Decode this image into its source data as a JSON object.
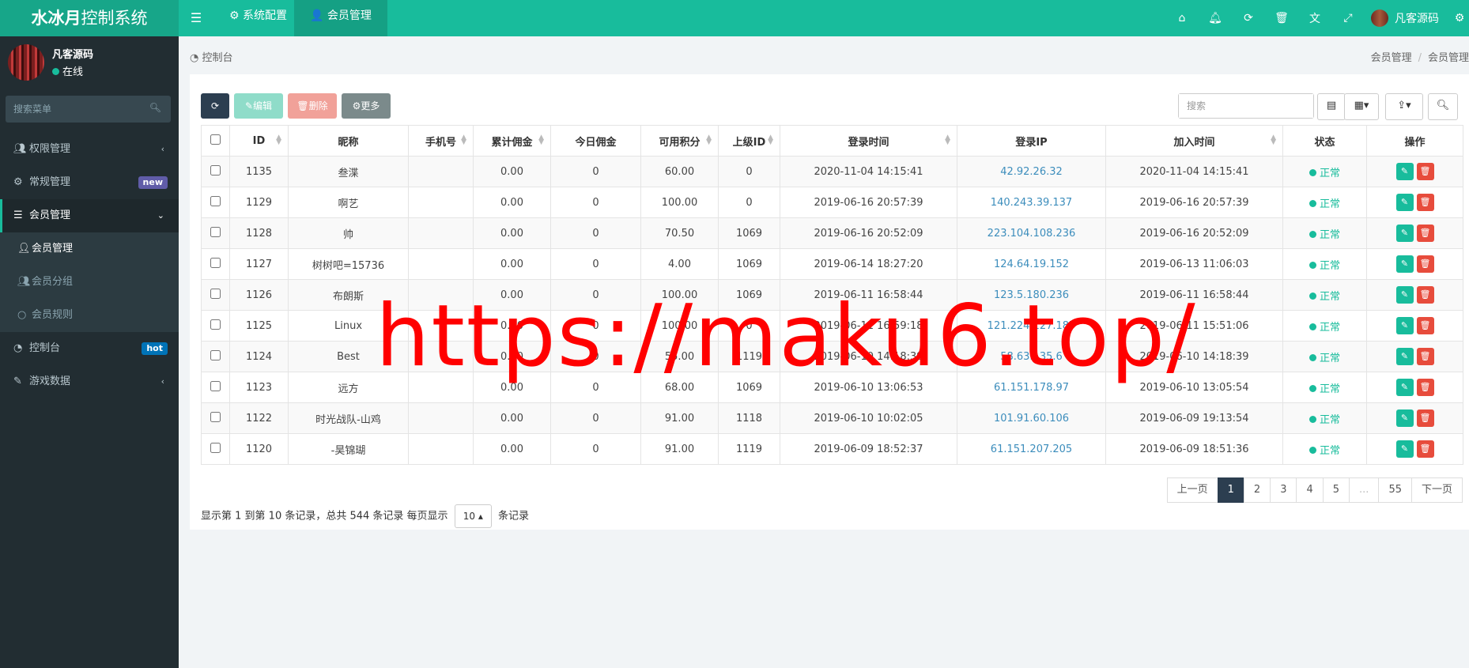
{
  "app": {
    "title_bold": "水冰月",
    "title_rest": "控制系统"
  },
  "topnav": {
    "tabs": [
      {
        "icon": "gear-icon",
        "label": "系统配置"
      },
      {
        "icon": "user-icon",
        "label": "会员管理"
      }
    ],
    "icons": [
      "home-icon",
      "bell-icon",
      "refresh-icon",
      "trash-icon",
      "translate-icon",
      "fullscreen-icon"
    ],
    "user": "凡客源码"
  },
  "sidebar": {
    "user": {
      "name": "凡客源码",
      "status": "在线"
    },
    "search_placeholder": "搜索菜单",
    "items": [
      {
        "icon": "users-icon",
        "label": "权限管理",
        "arrow": "‹"
      },
      {
        "icon": "cogs-icon",
        "label": "常规管理",
        "badge": "new",
        "badge_color": "#605ca8"
      },
      {
        "icon": "list-icon",
        "label": "会员管理",
        "arrow": "⌄"
      },
      {
        "icon": "dashboard-icon",
        "label": "控制台",
        "badge": "hot",
        "badge_color": "#0073b7"
      },
      {
        "icon": "magic-icon",
        "label": "游戏数据",
        "arrow": "‹"
      }
    ],
    "subitems": [
      {
        "icon": "user-icon",
        "label": "会员管理"
      },
      {
        "icon": "users-icon",
        "label": "会员分组"
      },
      {
        "icon": "circle-icon",
        "label": "会员规则"
      }
    ]
  },
  "breadcrumb": {
    "left": "控制台",
    "right": [
      "会员管理",
      "会员管理"
    ]
  },
  "toolbar": {
    "edit": "编辑",
    "delete": "删除",
    "more": "更多",
    "search_placeholder": "搜索"
  },
  "table": {
    "headers": [
      "ID",
      "昵称",
      "手机号",
      "累计佣金",
      "今日佣金",
      "可用积分",
      "上级ID",
      "登录时间",
      "登录IP",
      "加入时间",
      "状态",
      "操作"
    ],
    "rows": [
      [
        "1135",
        "叁渫",
        "",
        "0.00",
        "0",
        "60.00",
        "0",
        "2020-11-04 14:15:41",
        "42.92.26.32",
        "2020-11-04 14:15:41",
        "正常"
      ],
      [
        "1129",
        "啊艺",
        "",
        "0.00",
        "0",
        "100.00",
        "0",
        "2019-06-16 20:57:39",
        "140.243.39.137",
        "2019-06-16 20:57:39",
        "正常"
      ],
      [
        "1128",
        "帅",
        "",
        "0.00",
        "0",
        "70.50",
        "1069",
        "2019-06-16 20:52:09",
        "223.104.108.236",
        "2019-06-16 20:52:09",
        "正常"
      ],
      [
        "1127",
        "树树吧=15736",
        "",
        "0.00",
        "0",
        "4.00",
        "1069",
        "2019-06-14 18:27:20",
        "124.64.19.152",
        "2019-06-13 11:06:03",
        "正常"
      ],
      [
        "1126",
        "布朗斯",
        "",
        "0.00",
        "0",
        "100.00",
        "1069",
        "2019-06-11 16:58:44",
        "123.5.180.236",
        "2019-06-11 16:58:44",
        "正常"
      ],
      [
        "1125",
        "Linux",
        "",
        "0.00",
        "0",
        "100.00",
        "0",
        "2019-06-11 16:59:18",
        "121.224.127.187",
        "2019-06-11 15:51:06",
        "正常"
      ],
      [
        "1124",
        "Best",
        "",
        "0.00",
        "0",
        "55.00",
        "1119",
        "2019-06-10 14:18:39",
        "58.63.135.6",
        "2019-06-10 14:18:39",
        "正常"
      ],
      [
        "1123",
        "远方",
        "",
        "0.00",
        "0",
        "68.00",
        "1069",
        "2019-06-10 13:06:53",
        "61.151.178.97",
        "2019-06-10 13:05:54",
        "正常"
      ],
      [
        "1122",
        "时光战队-山鸡",
        "",
        "0.00",
        "0",
        "91.00",
        "1118",
        "2019-06-10 10:02:05",
        "101.91.60.106",
        "2019-06-09 19:13:54",
        "正常"
      ],
      [
        "1120",
        "-昊锦瑚",
        "",
        "0.00",
        "0",
        "91.00",
        "1119",
        "2019-06-09 18:52:37",
        "61.151.207.205",
        "2019-06-09 18:51:36",
        "正常"
      ]
    ]
  },
  "pagination": {
    "info_prefix": "显示第 1 到第 10 条记录，总共 544 条记录 每页显示",
    "page_size": "10",
    "info_suffix": "条记录",
    "prev": "上一页",
    "pages": [
      "1",
      "2",
      "3",
      "4",
      "5",
      "...",
      "55"
    ],
    "next": "下一页"
  },
  "watermark": "https://maku6.top/",
  "colors": {
    "primary": "#18bc9c",
    "sidebar": "#222d32",
    "danger": "#e74c3c",
    "link": "#3c8dbc"
  }
}
